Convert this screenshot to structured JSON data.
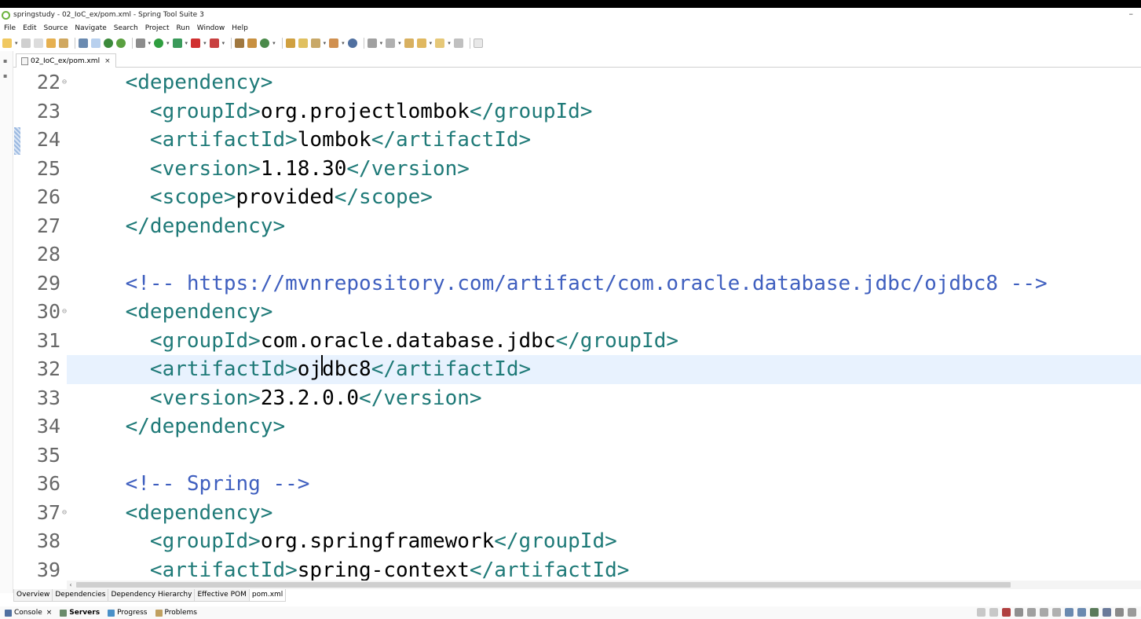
{
  "window": {
    "title": "springstudy - 02_IoC_ex/pom.xml - Spring Tool Suite 3",
    "minimize_glyph": "–"
  },
  "menu": [
    "File",
    "Edit",
    "Source",
    "Navigate",
    "Search",
    "Project",
    "Run",
    "Window",
    "Help"
  ],
  "editor_tab": {
    "label": "02_IoC_ex/pom.xml",
    "close_glyph": "×"
  },
  "editor": {
    "current_line": 32,
    "lines": [
      {
        "num": "22",
        "fold": "⊖",
        "indent": "    ",
        "parts": [
          {
            "t": "tag",
            "v": "<dependency>"
          }
        ]
      },
      {
        "num": "23",
        "fold": "",
        "indent": "      ",
        "parts": [
          {
            "t": "tag",
            "v": "<groupId>"
          },
          {
            "t": "txt",
            "v": "org.projectlombok"
          },
          {
            "t": "tag",
            "v": "</groupId>"
          }
        ]
      },
      {
        "num": "24",
        "fold": "",
        "indent": "      ",
        "parts": [
          {
            "t": "tag",
            "v": "<artifactId>"
          },
          {
            "t": "txt",
            "v": "lombok"
          },
          {
            "t": "tag",
            "v": "</artifactId>"
          }
        ]
      },
      {
        "num": "25",
        "fold": "",
        "indent": "      ",
        "parts": [
          {
            "t": "tag",
            "v": "<version>"
          },
          {
            "t": "txt",
            "v": "1.18.30"
          },
          {
            "t": "tag",
            "v": "</version>"
          }
        ]
      },
      {
        "num": "26",
        "fold": "",
        "indent": "      ",
        "parts": [
          {
            "t": "tag",
            "v": "<scope>"
          },
          {
            "t": "txt",
            "v": "provided"
          },
          {
            "t": "tag",
            "v": "</scope>"
          }
        ]
      },
      {
        "num": "27",
        "fold": "",
        "indent": "    ",
        "parts": [
          {
            "t": "tag",
            "v": "</dependency>"
          }
        ]
      },
      {
        "num": "28",
        "fold": "",
        "indent": "",
        "parts": []
      },
      {
        "num": "29",
        "fold": "",
        "indent": "    ",
        "parts": [
          {
            "t": "cmt",
            "v": "<!-- https://mvnrepository.com/artifact/com.oracle.database.jdbc/ojdbc8 -->"
          }
        ]
      },
      {
        "num": "30",
        "fold": "⊖",
        "indent": "    ",
        "parts": [
          {
            "t": "tag",
            "v": "<dependency>"
          }
        ]
      },
      {
        "num": "31",
        "fold": "",
        "indent": "      ",
        "parts": [
          {
            "t": "tag",
            "v": "<groupId>"
          },
          {
            "t": "txt",
            "v": "com.oracle.database.jdbc"
          },
          {
            "t": "tag",
            "v": "</groupId>"
          }
        ]
      },
      {
        "num": "32",
        "fold": "",
        "indent": "      ",
        "parts": [
          {
            "t": "tag",
            "v": "<artifactId>"
          },
          {
            "t": "txt",
            "v": "oj"
          },
          {
            "t": "caret",
            "v": ""
          },
          {
            "t": "txt",
            "v": "dbc8"
          },
          {
            "t": "tag",
            "v": "</artifactId>"
          }
        ]
      },
      {
        "num": "33",
        "fold": "",
        "indent": "      ",
        "parts": [
          {
            "t": "tag",
            "v": "<version>"
          },
          {
            "t": "txt",
            "v": "23.2.0.0"
          },
          {
            "t": "tag",
            "v": "</version>"
          }
        ]
      },
      {
        "num": "34",
        "fold": "",
        "indent": "    ",
        "parts": [
          {
            "t": "tag",
            "v": "</dependency>"
          }
        ]
      },
      {
        "num": "35",
        "fold": "",
        "indent": "",
        "parts": []
      },
      {
        "num": "36",
        "fold": "",
        "indent": "    ",
        "parts": [
          {
            "t": "cmt",
            "v": "<!-- Spring -->"
          }
        ]
      },
      {
        "num": "37",
        "fold": "⊖",
        "indent": "    ",
        "parts": [
          {
            "t": "tag",
            "v": "<dependency>"
          }
        ]
      },
      {
        "num": "38",
        "fold": "",
        "indent": "      ",
        "parts": [
          {
            "t": "tag",
            "v": "<groupId>"
          },
          {
            "t": "txt",
            "v": "org.springframework"
          },
          {
            "t": "tag",
            "v": "</groupId>"
          }
        ]
      },
      {
        "num": "39",
        "fold": "",
        "indent": "      ",
        "parts": [
          {
            "t": "tag",
            "v": "<artifactId>"
          },
          {
            "t": "txt",
            "v": "spring-context"
          },
          {
            "t": "tag",
            "v": "</artifactId>"
          }
        ]
      }
    ]
  },
  "pom_tabs": [
    "Overview",
    "Dependencies",
    "Dependency Hierarchy",
    "Effective POM",
    "pom.xml"
  ],
  "pom_active_tab": "pom.xml",
  "bottom_views": [
    {
      "label": "Console",
      "icon": "console-icon",
      "close": "×"
    },
    {
      "label": "Servers",
      "icon": "servers-icon",
      "active": true
    },
    {
      "label": "Progress",
      "icon": "progress-icon"
    },
    {
      "label": "Problems",
      "icon": "problems-icon"
    }
  ],
  "colors": {
    "tag": "#1f7a78",
    "comment": "#3f5fbf",
    "current_line_bg": "#e8f2fe",
    "spring_green": "#6db33f"
  }
}
